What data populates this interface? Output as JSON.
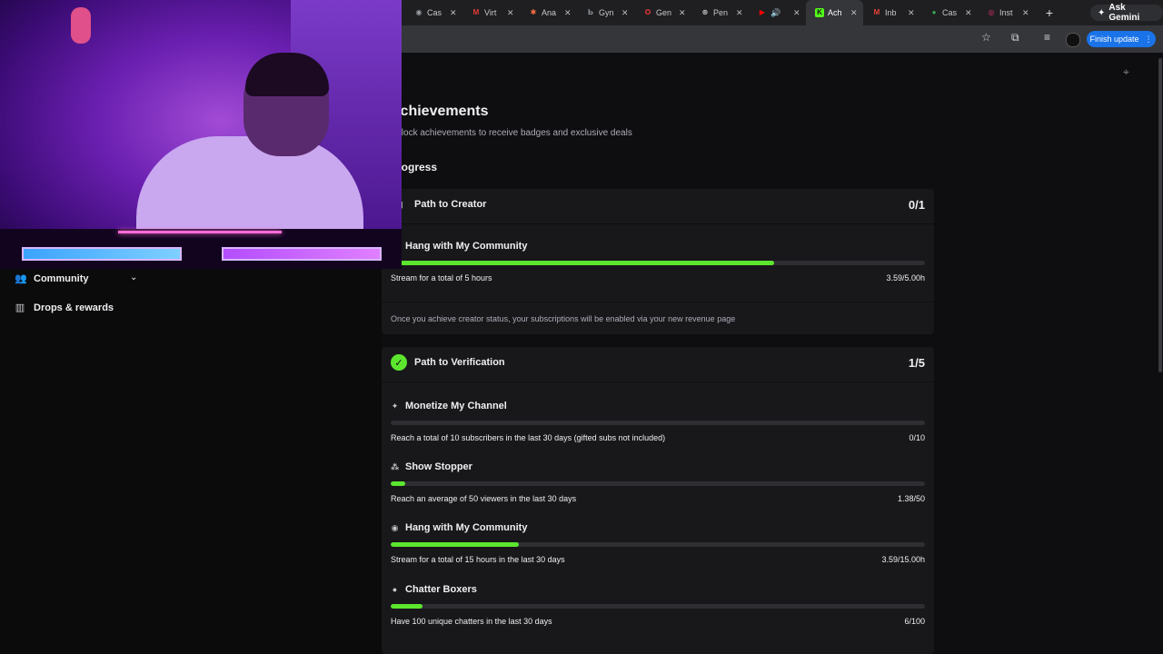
{
  "browser": {
    "tabs": [
      {
        "label": "Cas",
        "color": "#9aa0a6",
        "glyph": "◉"
      },
      {
        "label": "Virt",
        "color": "#e53935",
        "glyph": "M"
      },
      {
        "label": "Ana",
        "color": "#ff7043",
        "glyph": "✱"
      },
      {
        "label": "Gyn",
        "color": "#9aa0a6",
        "glyph": "Ь"
      },
      {
        "label": "Gen",
        "color": "#e53935",
        "glyph": "✪"
      },
      {
        "label": "Pen",
        "color": "#cfcfcf",
        "glyph": "⊛"
      },
      {
        "label": "",
        "color": "#ff0000",
        "glyph": "▶"
      },
      {
        "label": "Ach",
        "color": "#53fc18",
        "glyph": "K",
        "active": true
      },
      {
        "label": "Inb",
        "color": "#ea4335",
        "glyph": "M"
      },
      {
        "label": "Cas",
        "color": "#34a853",
        "glyph": "●"
      },
      {
        "label": "Inst",
        "color": "#e1306c",
        "glyph": "◎"
      }
    ],
    "ask_gemini": "Ask Gemini",
    "finish_update": "Finish update"
  },
  "sidebar": {
    "items": [
      {
        "label": "Community",
        "icon": "users-icon"
      },
      {
        "label": "Drops & rewards",
        "icon": "gift-icon"
      }
    ]
  },
  "page": {
    "title": "Achievements",
    "subtitle": "Unlock achievements to receive badges and exclusive deals",
    "section": "Progress"
  },
  "creator": {
    "title": "Path to Creator",
    "count": "0/1",
    "achievements": [
      {
        "name": "Hang with My Community",
        "desc": "Stream for a total of 5 hours",
        "value": "3.59/5.00h",
        "progress": 0.718
      }
    ],
    "note": "Once you achieve creator status, your subscriptions will be enabled via your new revenue page"
  },
  "verification": {
    "title": "Path to Verification",
    "count": "1/5",
    "achievements": [
      {
        "name": "Monetize My Channel",
        "desc": "Reach a total of 10 subscribers in the last 30 days (gifted subs not included)",
        "value": "0/10",
        "progress": 0.0
      },
      {
        "name": "Show Stopper",
        "desc": "Reach an average of 50 viewers in the last 30 days",
        "value": "1.38/50",
        "progress": 0.028
      },
      {
        "name": "Hang with My Community",
        "desc": "Stream for a total of 15 hours in the last 30 days",
        "value": "3.59/15.00h",
        "progress": 0.239
      },
      {
        "name": "Chatter Boxers",
        "desc": "Have 100 unique chatters in the last 30 days",
        "value": "6/100",
        "progress": 0.06
      }
    ]
  },
  "colors": {
    "accent": "#5ce62e",
    "card": "#18181b",
    "background": "#0e0e10"
  }
}
